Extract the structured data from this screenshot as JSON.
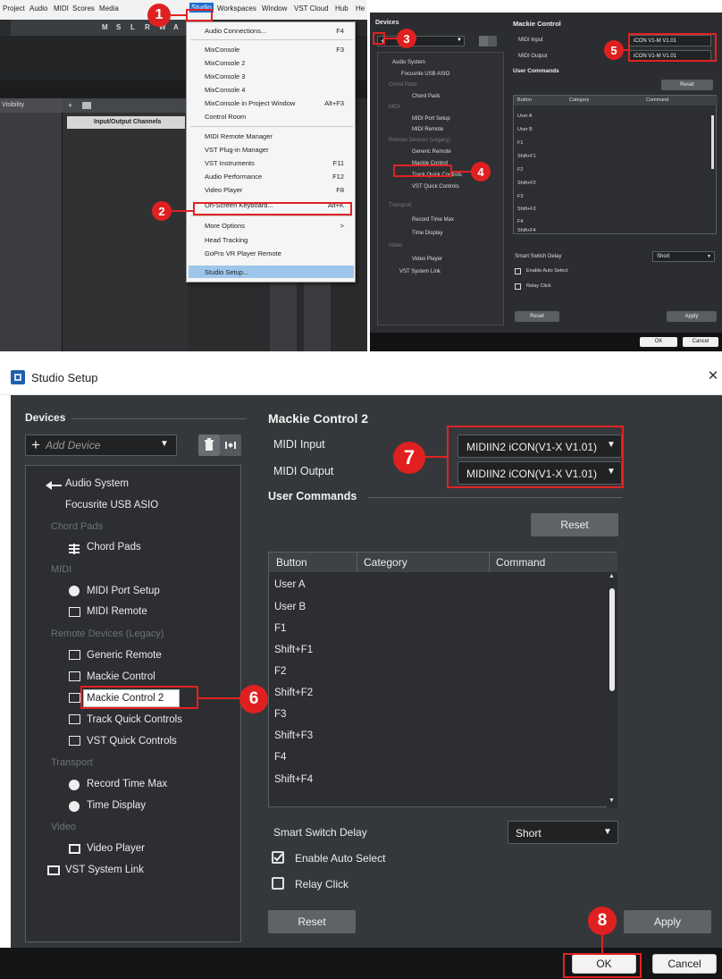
{
  "top_left": {
    "menu": [
      "Project",
      "Audio",
      "MIDI",
      "Scores",
      "Media",
      "Studio",
      "Workspaces",
      "Window",
      "VST Cloud",
      "Hub",
      "He"
    ],
    "toolbar_buttons": [
      "M",
      "S",
      "L",
      "R",
      "W",
      "A"
    ],
    "visibility_label": "Visibility",
    "track_header": "Input/Output Channels",
    "studio_menu_items": [
      {
        "label": "Audio Connections...",
        "shortcut": "F4"
      },
      {
        "label": "MixConsole",
        "shortcut": "F3"
      },
      {
        "label": "MixConsole 2",
        "shortcut": ""
      },
      {
        "label": "MixConsole 3",
        "shortcut": ""
      },
      {
        "label": "MixConsole 4",
        "shortcut": ""
      },
      {
        "label": "MixConsole in Project Window",
        "shortcut": "Alt+F3"
      },
      {
        "label": "Control Room",
        "shortcut": ""
      },
      {
        "label": "MIDI Remote Manager",
        "shortcut": ""
      },
      {
        "label": "VST Plug-in Manager",
        "shortcut": ""
      },
      {
        "label": "VST Instruments",
        "shortcut": "F11"
      },
      {
        "label": "Audio Performance",
        "shortcut": "F12"
      },
      {
        "label": "Video Player",
        "shortcut": "F8"
      },
      {
        "label": "On-Screen Keyboard...",
        "shortcut": "Alt+K"
      },
      {
        "label": "More Options",
        "shortcut": ">"
      },
      {
        "label": "Head Tracking",
        "shortcut": ""
      },
      {
        "label": "GoPro VR Player Remote",
        "shortcut": ""
      },
      {
        "label": "Studio Setup...",
        "shortcut": ""
      }
    ]
  },
  "top_right": {
    "devices_label": "Devices",
    "add_icon": "+",
    "device_tree": [
      {
        "kind": "item",
        "label": "Audio System"
      },
      {
        "kind": "item",
        "label": "Focusrite USB ASIO"
      },
      {
        "kind": "cat",
        "label": "Chord Pads"
      },
      {
        "kind": "item",
        "label": "Chord Pads"
      },
      {
        "kind": "cat",
        "label": "MIDI"
      },
      {
        "kind": "item",
        "label": "MIDI Port Setup"
      },
      {
        "kind": "item",
        "label": "MIDI Remote"
      },
      {
        "kind": "cat",
        "label": "Remote Devices (Legacy)"
      },
      {
        "kind": "item",
        "label": "Generic Remote"
      },
      {
        "kind": "item",
        "label": "Mackie Control"
      },
      {
        "kind": "item",
        "label": "Track Quick Controls"
      },
      {
        "kind": "item",
        "label": "VST Quick Controls"
      },
      {
        "kind": "cat",
        "label": "Transport"
      },
      {
        "kind": "item",
        "label": "Record Time Max"
      },
      {
        "kind": "item",
        "label": "Time Display"
      },
      {
        "kind": "cat",
        "label": "Video"
      },
      {
        "kind": "item",
        "label": "Video Player"
      },
      {
        "kind": "item",
        "label": "VST System Link"
      }
    ],
    "title": "Mackie Control",
    "midi_input_label": "MIDI Input",
    "midi_output_label": "MIDI Output",
    "midi_input_value": "iCON V1-M V1.01",
    "midi_output_value": "iCON V1-M V1.01",
    "user_commands": "User Commands",
    "reset": "Reset",
    "table_headers": [
      "Button",
      "Category",
      "Command"
    ],
    "rows": [
      "User A",
      "User B",
      "F1",
      "Shift+F1",
      "F2",
      "Shift+F2",
      "F3",
      "Shift+F3",
      "F4",
      "Shift+F4"
    ],
    "smart_switch": "Smart Switch Delay",
    "smart_switch_value": "Short",
    "enable_auto_select": "Enable Auto Select",
    "relay_click": "Relay Click",
    "reset_bottom": "Reset",
    "apply": "Apply",
    "ok": "OK",
    "cancel": "Cancel"
  },
  "dialog": {
    "title": "Studio Setup",
    "close": "✕",
    "devices_label": "Devices",
    "add_device": "Add Device",
    "tree": [
      {
        "kind": "item",
        "label": "Audio System",
        "icon": "audio-system-icon",
        "indent": 1
      },
      {
        "kind": "item",
        "label": "Focusrite USB ASIO",
        "icon": "",
        "indent": 2
      },
      {
        "kind": "cat",
        "label": "Chord Pads"
      },
      {
        "kind": "item",
        "label": "Chord Pads",
        "icon": "chord-pads-icon",
        "indent": 2
      },
      {
        "kind": "cat",
        "label": "MIDI"
      },
      {
        "kind": "item",
        "label": "MIDI Port Setup",
        "icon": "midi-port-icon",
        "indent": 2
      },
      {
        "kind": "item",
        "label": "MIDI Remote",
        "icon": "keyboard-icon",
        "indent": 2
      },
      {
        "kind": "cat",
        "label": "Remote Devices (Legacy)"
      },
      {
        "kind": "item",
        "label": "Generic Remote",
        "icon": "keyboard-icon",
        "indent": 2
      },
      {
        "kind": "item",
        "label": "Mackie Control",
        "icon": "keyboard-icon",
        "indent": 2
      },
      {
        "kind": "item",
        "label": "Mackie Control 2",
        "icon": "keyboard-icon",
        "indent": 2
      },
      {
        "kind": "item",
        "label": "Track Quick Controls",
        "icon": "keyboard-icon",
        "indent": 2
      },
      {
        "kind": "item",
        "label": "VST Quick Controls",
        "icon": "keyboard-icon",
        "indent": 2
      },
      {
        "kind": "cat",
        "label": "Transport"
      },
      {
        "kind": "item",
        "label": "Record Time Max",
        "icon": "clock-icon",
        "indent": 2
      },
      {
        "kind": "item",
        "label": "Time Display",
        "icon": "clock-icon",
        "indent": 2
      },
      {
        "kind": "cat",
        "label": "Video"
      },
      {
        "kind": "item",
        "label": "Video Player",
        "icon": "video-icon",
        "indent": 2
      },
      {
        "kind": "item",
        "label": "VST System Link",
        "icon": "monitor-icon",
        "indent": 1
      }
    ],
    "device_title": "Mackie Control 2",
    "midi_input_label": "MIDI Input",
    "midi_output_label": "MIDI Output",
    "midi_input_value": "MIDIIN2 iCON(V1-X V1.01)",
    "midi_output_value": "MIDIIN2 iCON(V1-X V1.01)",
    "user_commands": "User Commands",
    "reset_top": "Reset",
    "table_headers": [
      "Button",
      "Category",
      "Command"
    ],
    "rows": [
      "User A",
      "User B",
      "F1",
      "Shift+F1",
      "F2",
      "Shift+F2",
      "F3",
      "Shift+F3",
      "F4",
      "Shift+F4"
    ],
    "smart_switch": "Smart Switch Delay",
    "smart_switch_value": "Short",
    "enable_auto_select": "Enable Auto Select",
    "enable_auto_select_checked": true,
    "relay_click": "Relay Click",
    "relay_click_checked": false,
    "reset_bottom": "Reset",
    "apply": "Apply",
    "ok": "OK",
    "cancel": "Cancel"
  },
  "markers": [
    "1",
    "2",
    "3",
    "4",
    "5",
    "6",
    "7",
    "8"
  ],
  "colors": {
    "marker": "#e02020",
    "dark_bg": "#35383b",
    "selection": "#9ec5ea"
  }
}
